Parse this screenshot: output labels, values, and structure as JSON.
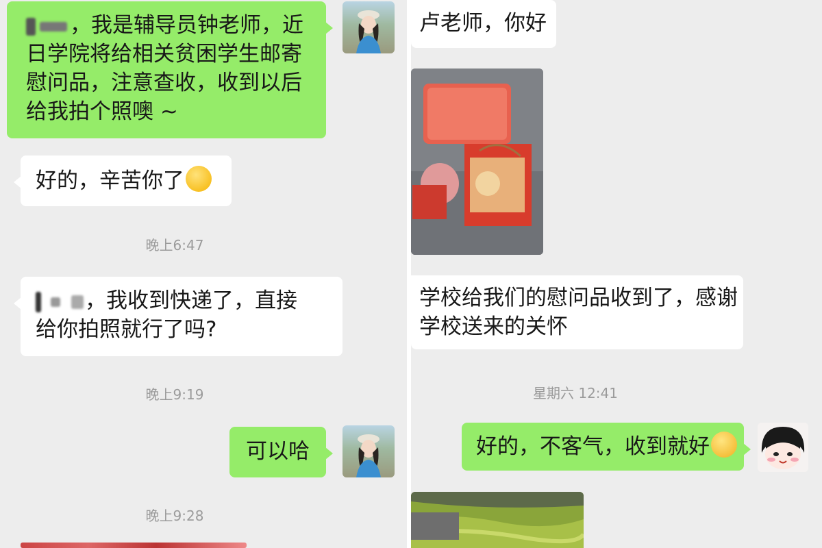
{
  "left": {
    "messages": [
      {
        "text": "，我是辅导员钟老师，近\n日学院将给相关贫困学生邮寄\n慰问品，注意查收，收到以后\n给我拍个照噢 ~"
      },
      {
        "text": "好的，辛苦你了"
      },
      {
        "text": "，我收到快递了，直接\n给你拍照就行了吗?"
      },
      {
        "text": "可以哈"
      }
    ],
    "timestamps": [
      "晚上6:47",
      "晚上9:19",
      "晚上9:28"
    ]
  },
  "right": {
    "messages": [
      {
        "text": "卢老师，你好"
      },
      {
        "text": "学校给我们的慰问品收到了，感谢\n学校送来的关怀"
      },
      {
        "text": "好的，不客气，收到就好"
      }
    ],
    "timestamps": [
      "星期六 12:41"
    ]
  },
  "icons": {
    "smirk_emoji": "smirk-emoji-icon",
    "smile_emoji": "smile-emoji-icon",
    "teacher_avatar": "avatar-girl-photo",
    "cartoon_avatar": "avatar-cartoon-girl"
  },
  "colors": {
    "background": "#ededed",
    "sent_bubble": "#95ec69",
    "received_bubble": "#ffffff",
    "timestamp": "#9b9b9b"
  }
}
